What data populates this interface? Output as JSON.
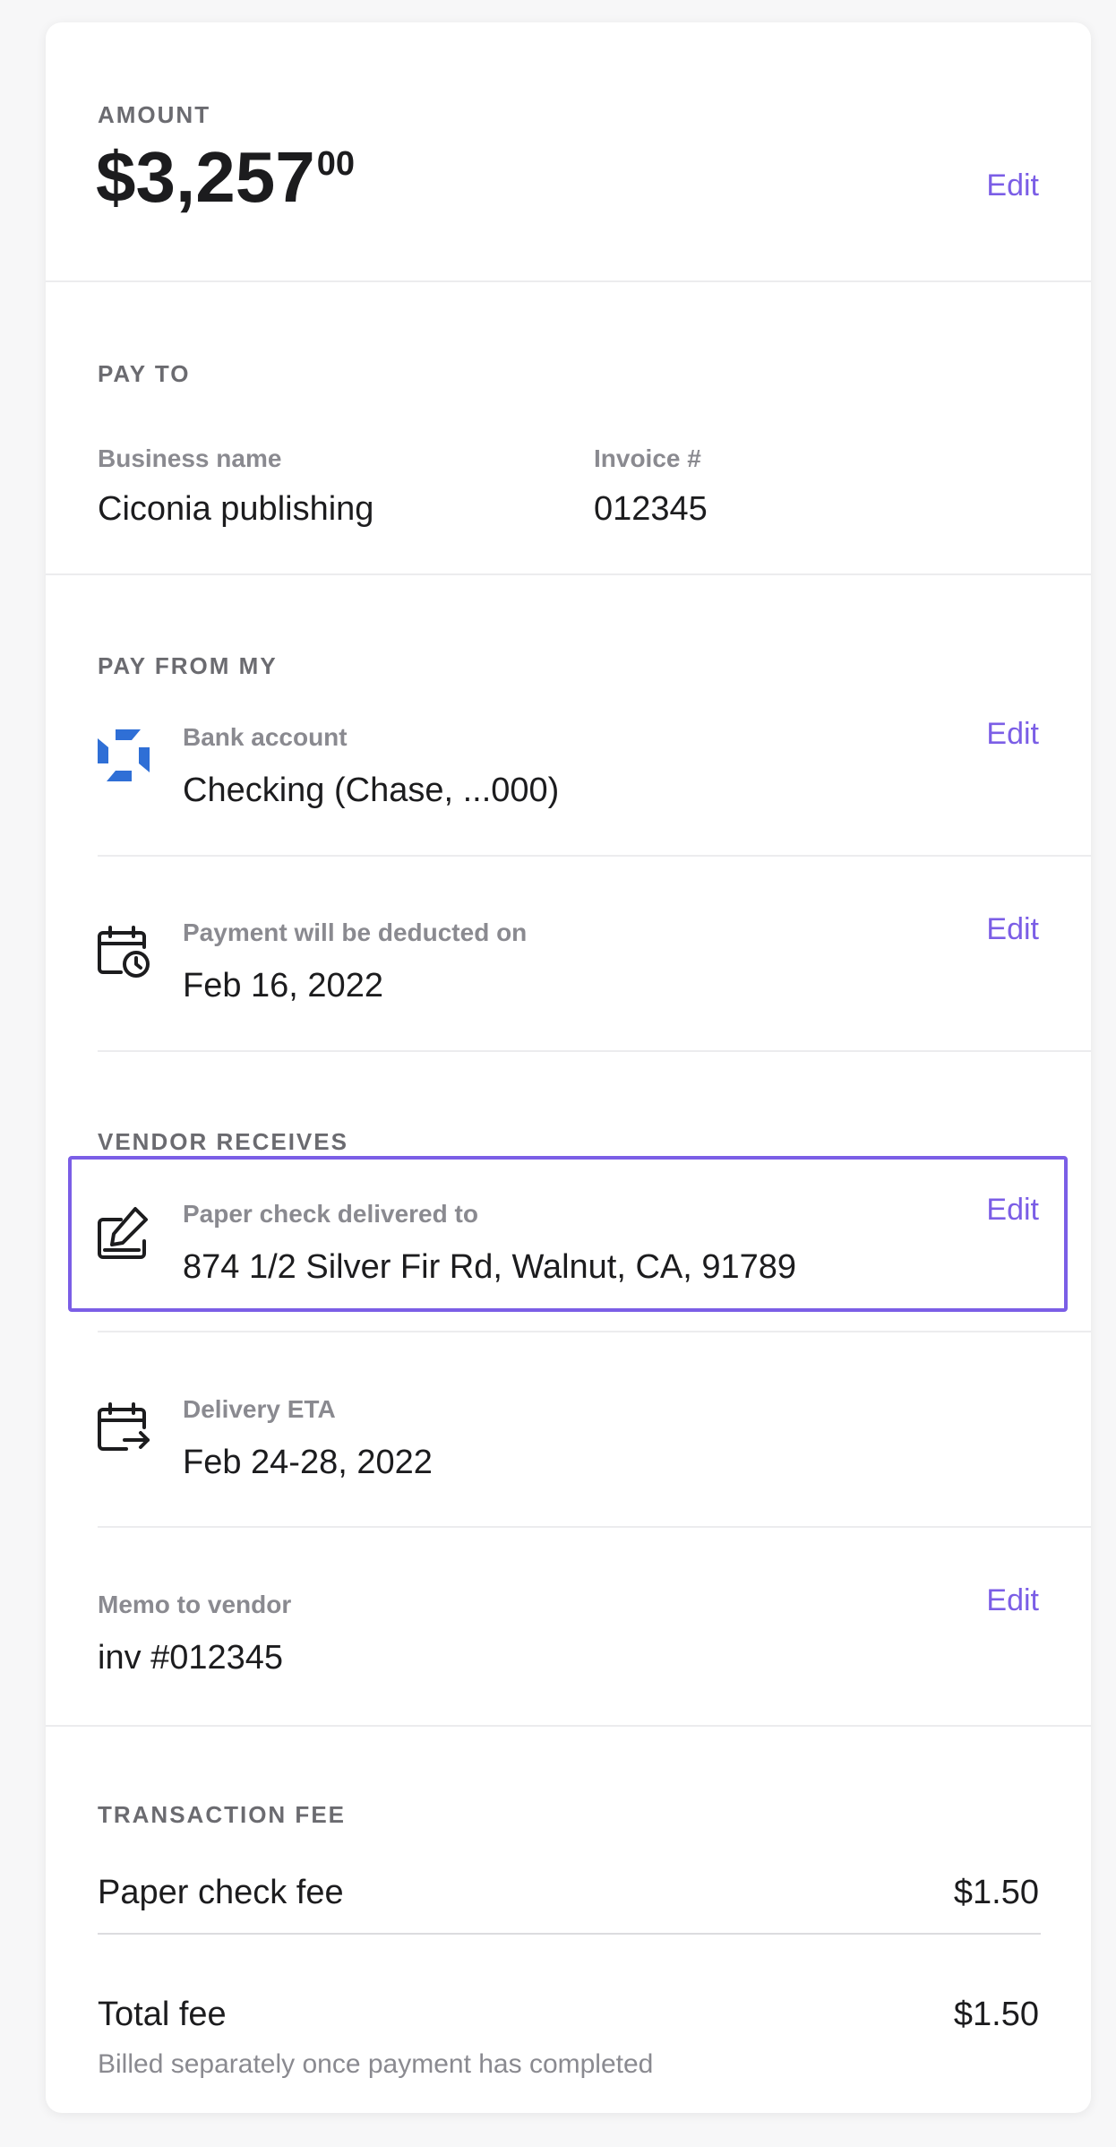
{
  "amount": {
    "label": "AMOUNT",
    "value_main": "$3,257",
    "value_cents": "00",
    "edit_label": "Edit"
  },
  "pay_to": {
    "label": "PAY TO",
    "business_name_label": "Business name",
    "business_name_value": "Ciconia publishing",
    "invoice_label": "Invoice #",
    "invoice_value": "012345"
  },
  "pay_from": {
    "label": "PAY FROM MY",
    "bank_account_label": "Bank account",
    "bank_account_value": "Checking (Chase, ...000)",
    "bank_edit_label": "Edit",
    "deduct_label": "Payment will be deducted on",
    "deduct_value": "Feb 16, 2022",
    "deduct_edit_label": "Edit"
  },
  "vendor_receives": {
    "label": "VENDOR RECEIVES",
    "delivery_label": "Paper check delivered to",
    "delivery_value": "874 1/2 Silver Fir Rd, Walnut, CA, 91789",
    "delivery_edit_label": "Edit",
    "eta_label": "Delivery ETA",
    "eta_value": "Feb 24-28, 2022",
    "memo_label": "Memo to vendor",
    "memo_value": "inv #012345",
    "memo_edit_label": "Edit"
  },
  "transaction_fee": {
    "label": "TRANSACTION FEE",
    "fee_name": "Paper check fee",
    "fee_value": "$1.50",
    "total_name": "Total fee",
    "total_value": "$1.50",
    "note": "Billed separately once payment has completed"
  },
  "colors": {
    "accent": "#7b5ee6",
    "chase_blue": "#2f6fd6"
  },
  "icons": {
    "bank": "chase-logo-icon",
    "deduct": "calendar-clock-icon",
    "delivery": "pen-edit-icon",
    "eta": "calendar-arrow-icon"
  }
}
